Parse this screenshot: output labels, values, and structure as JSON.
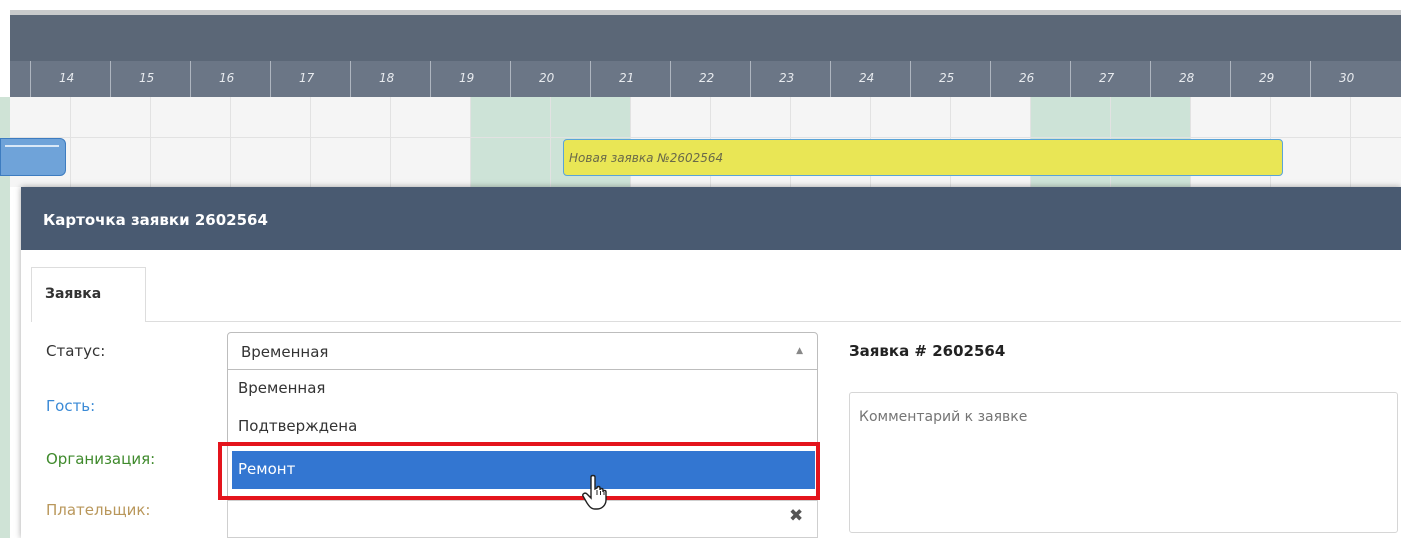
{
  "calendar": {
    "days": [
      "14",
      "15",
      "16",
      "17",
      "18",
      "19",
      "20",
      "21",
      "22",
      "23",
      "24",
      "25",
      "26",
      "27",
      "28",
      "29",
      "30"
    ],
    "booking_label": "Новая заявка №2602564"
  },
  "modal": {
    "title": "Карточка заявки 2602564",
    "tab_label": "Заявка",
    "fields": {
      "status_label": "Статус:",
      "guest_label": "Гость:",
      "organization_label": "Организация:",
      "payer_label": "Плательщик:"
    },
    "status_select": {
      "selected": "Временная",
      "options": [
        "Временная",
        "Подтверждена",
        "Ремонт"
      ],
      "highlighted": "Ремонт"
    },
    "order_title": "Заявка # 2602564",
    "comment_placeholder": "Комментарий к заявке",
    "clear_icon": "✖"
  },
  "colors": {
    "header_bg": "#495a71",
    "highlight": "#3376d1",
    "booking_yellow": "#e9e655",
    "frame_red": "#e4141c",
    "guest_label": "#3a8ad6",
    "organization_label": "#3f8a2c",
    "payer_label": "#b9975b"
  }
}
